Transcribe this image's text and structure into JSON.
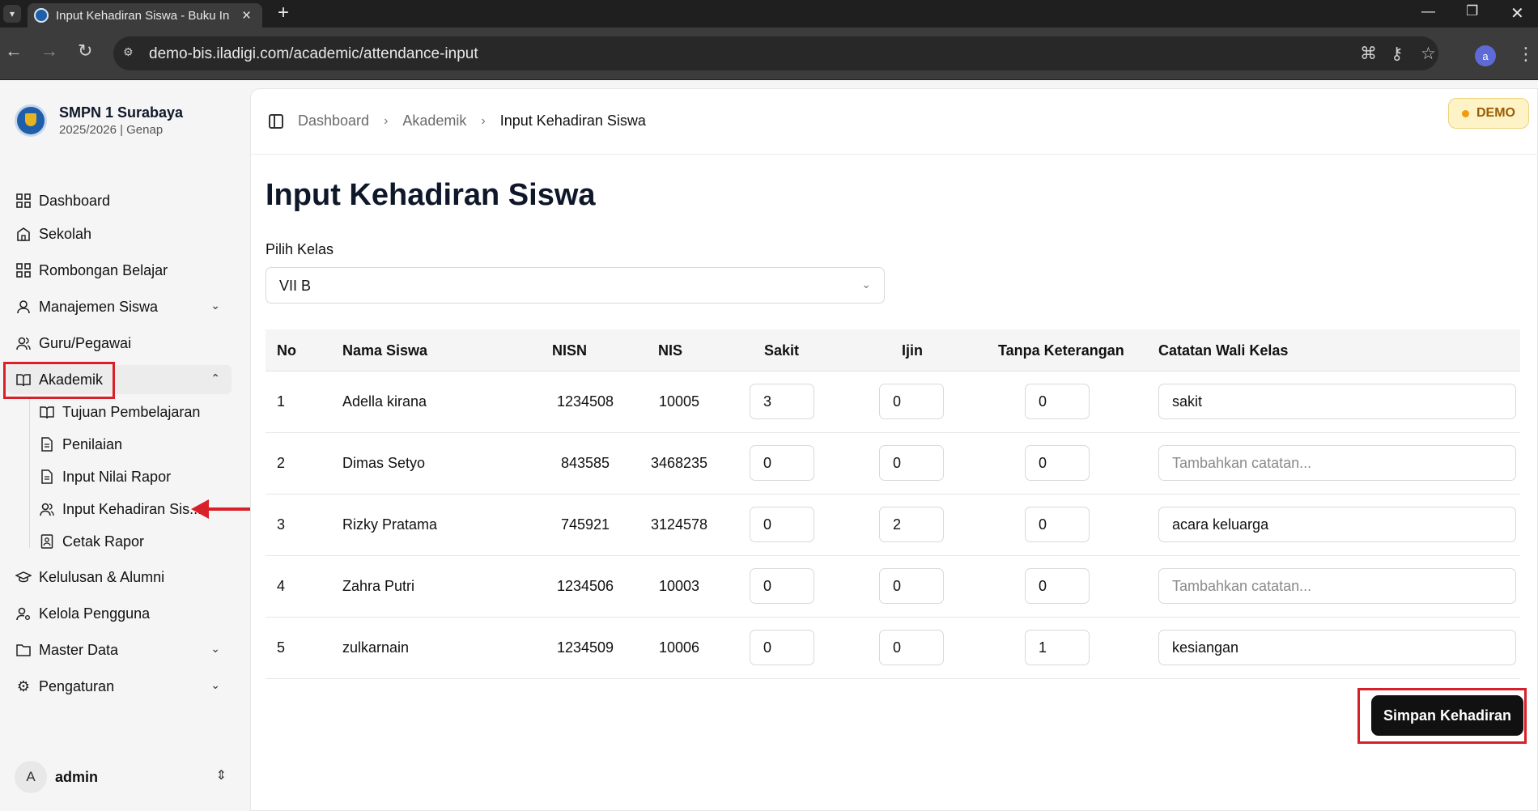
{
  "browser": {
    "tab_title": "Input Kehadiran Siswa - Buku In",
    "url": "demo-bis.iladigi.com/academic/attendance-input",
    "profile_initial": "a"
  },
  "sidebar": {
    "school_name": "SMPN 1 Surabaya",
    "school_year": "2025/2026 | Genap",
    "items": [
      {
        "label": "Dashboard",
        "icon": "grid-icon"
      },
      {
        "label": "Sekolah",
        "icon": "building-icon"
      },
      {
        "label": "Rombongan Belajar",
        "icon": "grid-icon"
      },
      {
        "label": "Manajemen Siswa",
        "icon": "user-icon"
      },
      {
        "label": "Guru/Pegawai",
        "icon": "users-icon"
      },
      {
        "label": "Akademik",
        "icon": "book-icon"
      },
      {
        "label": "Kelulusan & Alumni",
        "icon": "graduation-cap-icon"
      },
      {
        "label": "Kelola Pengguna",
        "icon": "user-cog-icon"
      },
      {
        "label": "Master Data",
        "icon": "folder-icon"
      },
      {
        "label": "Pengaturan",
        "icon": "gear-icon"
      }
    ],
    "akademik_sub": [
      {
        "label": "Tujuan Pembelajaran",
        "icon": "book-icon"
      },
      {
        "label": "Penilaian",
        "icon": "file-icon"
      },
      {
        "label": "Input Nilai Rapor",
        "icon": "file-icon"
      },
      {
        "label": "Input Kehadiran Sis...",
        "icon": "users-icon"
      },
      {
        "label": "Cetak Rapor",
        "icon": "report-icon"
      }
    ],
    "user": {
      "initial": "A",
      "name": "admin"
    }
  },
  "breadcrumb": {
    "items": [
      "Dashboard",
      "Akademik"
    ],
    "current": "Input Kehadiran Siswa"
  },
  "demo_badge": "DEMO",
  "page": {
    "title": "Input Kehadiran Siswa",
    "select_label": "Pilih Kelas",
    "selected_class": "VII B",
    "save_label": "Simpan Kehadiran"
  },
  "table": {
    "headers": [
      "No",
      "Nama Siswa",
      "NISN",
      "NIS",
      "Sakit",
      "Ijin",
      "Tanpa Keterangan",
      "Catatan Wali Kelas"
    ],
    "note_placeholder": "Tambahkan catatan...",
    "rows": [
      {
        "no": "1",
        "name": "Adella kirana",
        "nisn": "1234508",
        "nis": "10005",
        "sakit": "3",
        "ijin": "0",
        "tanpa": "0",
        "note": "sakit"
      },
      {
        "no": "2",
        "name": "Dimas Setyo",
        "nisn": "843585",
        "nis": "3468235",
        "sakit": "0",
        "ijin": "0",
        "tanpa": "0",
        "note": ""
      },
      {
        "no": "3",
        "name": "Rizky Pratama",
        "nisn": "745921",
        "nis": "3124578",
        "sakit": "0",
        "ijin": "2",
        "tanpa": "0",
        "note": "acara keluarga"
      },
      {
        "no": "4",
        "name": "Zahra Putri",
        "nisn": "1234506",
        "nis": "10003",
        "sakit": "0",
        "ijin": "0",
        "tanpa": "0",
        "note": ""
      },
      {
        "no": "5",
        "name": "zulkarnain",
        "nisn": "1234509",
        "nis": "10006",
        "sakit": "0",
        "ijin": "0",
        "tanpa": "1",
        "note": "kesiangan"
      }
    ]
  }
}
